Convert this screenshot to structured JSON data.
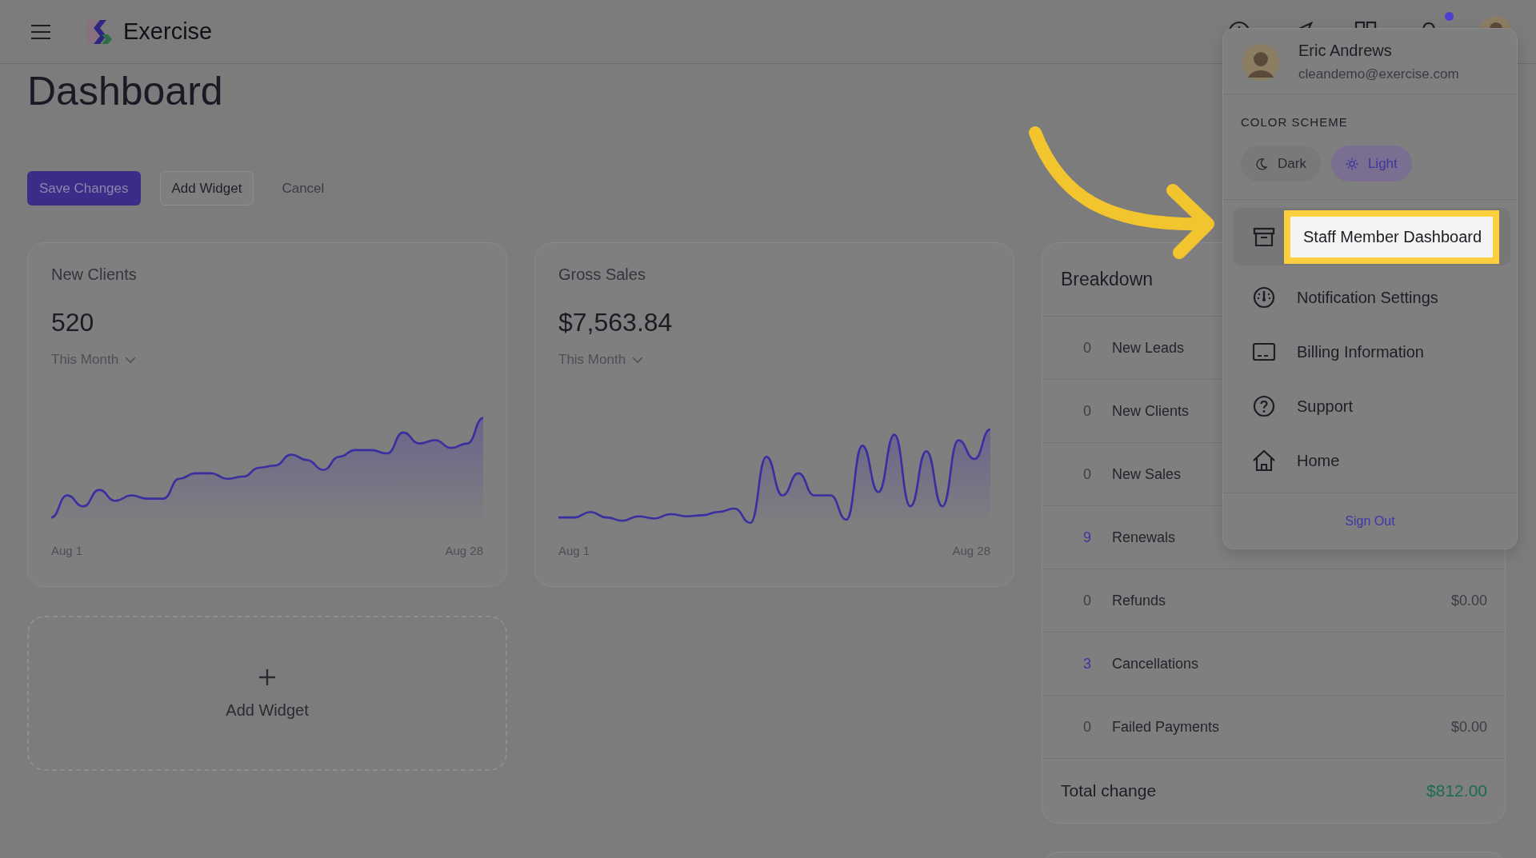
{
  "header": {
    "brand": "Exercise",
    "has_notification": true
  },
  "page_title": "Dashboard",
  "actions": [
    {
      "label": "Save Changes",
      "kind": "primary"
    },
    {
      "label": "Add Widget",
      "kind": "secondary"
    },
    {
      "label": "Cancel",
      "kind": "link"
    }
  ],
  "widgets": [
    {
      "title": "New Clients",
      "value": "520",
      "period": "This Month",
      "x_start": "Aug 1",
      "x_end": "Aug 28"
    },
    {
      "title": "Gross Sales",
      "value": "$7,563.84",
      "period": "This Month",
      "x_start": "Aug 1",
      "x_end": "Aug 28"
    }
  ],
  "add_widget": {
    "label": "Add Widget"
  },
  "breakdown": {
    "title": "Breakdown",
    "rows": [
      {
        "count": "0",
        "label": "New Leads",
        "color": "#3a3b44"
      },
      {
        "count": "0",
        "label": "New Clients",
        "color": "#3a3b44"
      },
      {
        "count": "0",
        "label": "New Sales",
        "color": "#3a3b44"
      },
      {
        "count": "9",
        "label": "Renewals",
        "color": "#3d35a0"
      },
      {
        "count": "0",
        "label": "Refunds",
        "amount": "$0.00",
        "color": "#3a3b44"
      },
      {
        "count": "3",
        "label": "Cancellations",
        "color": "#3d35a0"
      },
      {
        "count": "0",
        "label": "Failed Payments",
        "amount": "$0.00",
        "color": "#3a3b44"
      }
    ],
    "total_label": "Total change",
    "total": "$812.00"
  },
  "user_menu": {
    "name": "Eric Andrews",
    "email": "cleandemo@exercise.com",
    "section_title": "COLOR SCHEME",
    "schemes": [
      {
        "label": "Dark",
        "selected": false
      },
      {
        "label": "Light",
        "selected": true
      }
    ],
    "items": [
      {
        "label": "Staff Member Dashboard",
        "highlighted": true
      },
      {
        "label": "Notification Settings",
        "highlighted": false
      },
      {
        "label": "Billing Information",
        "highlighted": false
      },
      {
        "label": "Support",
        "highlighted": false
      },
      {
        "label": "Home",
        "highlighted": false
      }
    ],
    "sign_out": "Sign Out"
  }
}
